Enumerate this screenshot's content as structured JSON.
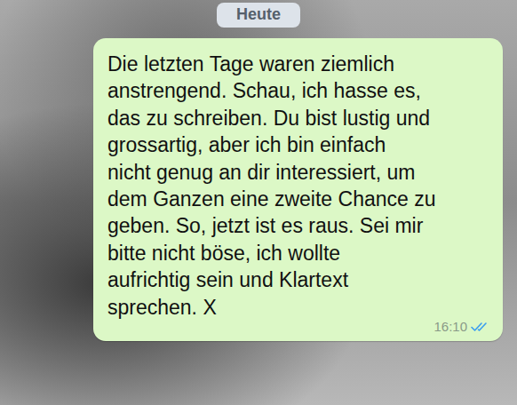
{
  "date": "Heute",
  "message": {
    "outgoing": true,
    "lines": [
      "Die letzten Tage waren ziemlich",
      "anstrengend. Schau, ich hasse es,",
      "das zu schreiben. Du bist lustig und",
      "grossartig, aber ich bin einfach",
      "nicht genug an dir interessiert, um",
      "dem Ganzen eine zweite Chance zu",
      "geben. So, jetzt ist es raus. Sei mir",
      "bitte nicht böse, ich wollte",
      "aufrichtig sein und Klartext",
      "sprechen. X"
    ],
    "time": "16:10",
    "read": true
  }
}
